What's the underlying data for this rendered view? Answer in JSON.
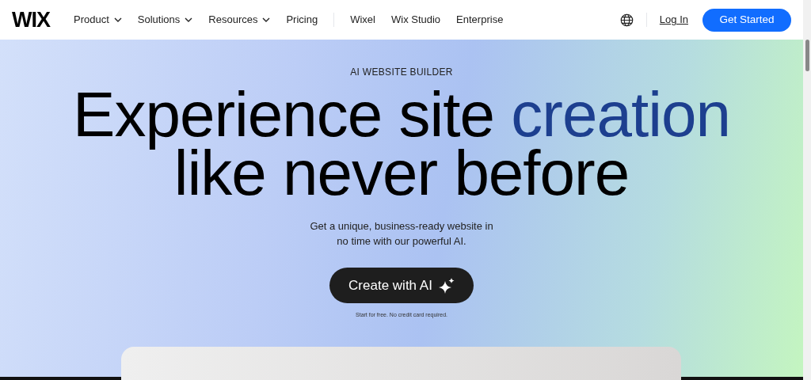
{
  "header": {
    "logo": "WIX",
    "nav": [
      {
        "label": "Product",
        "dropdown": true
      },
      {
        "label": "Solutions",
        "dropdown": true
      },
      {
        "label": "Resources",
        "dropdown": true
      },
      {
        "label": "Pricing",
        "dropdown": false
      }
    ],
    "nav_secondary": [
      "Wixel",
      "Wix Studio",
      "Enterprise"
    ],
    "login": "Log In",
    "cta": "Get Started"
  },
  "hero": {
    "eyebrow": "AI WEBSITE BUILDER",
    "headline": [
      [
        {
          "text": "Experience site ",
          "highlight": false
        },
        {
          "text": "creation",
          "highlight": true
        }
      ],
      [
        {
          "text": "like never before",
          "highlight": false
        }
      ]
    ],
    "subtitle": "Get a unique, business-ready website in no time with our powerful AI.",
    "button": "Create with AI",
    "note": "Start for free. No credit card required."
  }
}
